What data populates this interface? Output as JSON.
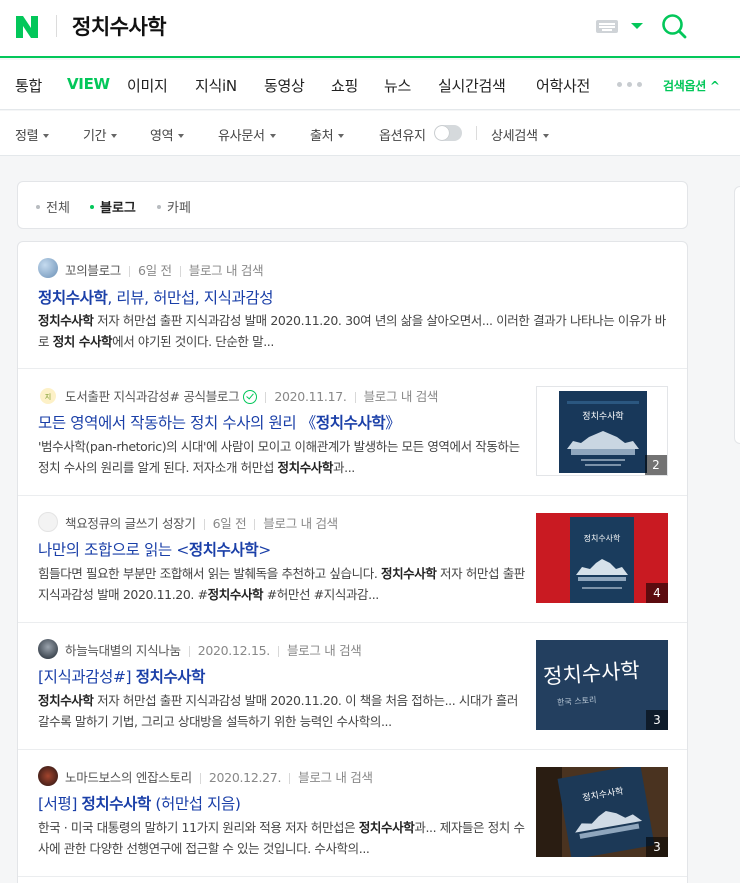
{
  "header": {
    "query": "정치수사학"
  },
  "colors": {
    "brand_green": "#03c75a",
    "link_blue": "#1a3fa8"
  },
  "nav": {
    "tabs": [
      "통합",
      "VIEW",
      "이미지",
      "지식iN",
      "동영상",
      "쇼핑",
      "뉴스",
      "실시간검색",
      "어학사전"
    ],
    "active": "VIEW",
    "search_options": "검색옵션 ^"
  },
  "filters": {
    "items": [
      "정렬",
      "기간",
      "영역",
      "유사문서",
      "출처"
    ],
    "keep_option": "옵션유지",
    "detail_search": "상세검색"
  },
  "subtabs": {
    "items": [
      "전체",
      "블로그",
      "카페"
    ],
    "active": "블로그"
  },
  "results": [
    {
      "source": "꼬의블로그",
      "date": "6일 전",
      "blog_search": "블로그 내 검색",
      "title_parts": [
        [
          "b",
          "정치수사학"
        ],
        [
          "",
          ", 리뷰, 허만섭, 지식과감성"
        ]
      ],
      "snippet_parts": [
        [
          "b",
          "정치수사학"
        ],
        [
          "",
          " 저자 허만섭 출판 지식과감성 발매 2020.11.20. 30여 년의 삶을 살아오면서... 이러한 결과가 나타나는 이유가 바로 "
        ],
        [
          "b",
          "정치 수사학"
        ],
        [
          "",
          "에서 야기된 것이다. 단순한 말..."
        ]
      ],
      "thumb_count": null
    },
    {
      "source": "도서출판 지식과감성# 공식블로그",
      "date": "2020.11.17.",
      "blog_search": "블로그 내 검색",
      "title_parts": [
        [
          "",
          "모든 영역에서 작동하는 정치 수사의 원리 《"
        ],
        [
          "b",
          "정치수사학"
        ],
        [
          "",
          "》"
        ]
      ],
      "snippet_parts": [
        [
          "",
          "'범수사학(pan-rhetoric)의 시대'에 사람이 모이고 이해관계가 발생하는 모든 영역에서 작동하는 정치 수사의 원리를 알게 된다. 저자소개 허만섭 "
        ],
        [
          "b",
          "정치수사학"
        ],
        [
          "",
          "과..."
        ]
      ],
      "thumb_count": "2"
    },
    {
      "source": "책요정큐의 글쓰기 성장기",
      "date": "6일 전",
      "blog_search": "블로그 내 검색",
      "title_parts": [
        [
          "",
          "나만의 조합으로 읽는 <"
        ],
        [
          "b",
          "정치수사학"
        ],
        [
          "",
          ">"
        ]
      ],
      "snippet_parts": [
        [
          "",
          "힘들다면 필요한 부분만 조합해서 읽는 발췌독을 추천하고 싶습니다. "
        ],
        [
          "b",
          "정치수사학"
        ],
        [
          "",
          " 저자 허만섭 출판 지식과감성 발매 2020.11.20. #"
        ],
        [
          "b",
          "정치수사학"
        ],
        [
          "",
          " #허만선 #지식과감..."
        ]
      ],
      "thumb_count": "4"
    },
    {
      "source": "하늘늑대별의 지식나눔",
      "date": "2020.12.15.",
      "blog_search": "블로그 내 검색",
      "title_parts": [
        [
          "",
          "[지식과감성#] "
        ],
        [
          "b",
          "정치수사학"
        ]
      ],
      "snippet_parts": [
        [
          "b",
          "정치수사학"
        ],
        [
          "",
          " 저자 허만섭 출판 지식과감성 발매 2020.11.20. 이 책을 처음 접하는... 시대가 흘러갈수록 말하기 기법, 그리고 상대방을 설득하기 위한 능력인 수사학의..."
        ]
      ],
      "thumb_count": "3"
    },
    {
      "source": "노마드보스의 엔잡스토리",
      "date": "2020.12.27.",
      "blog_search": "블로그 내 검색",
      "title_parts": [
        [
          "",
          "[서평] "
        ],
        [
          "b",
          "정치수사학"
        ],
        [
          "",
          " (허만섭 지음)"
        ]
      ],
      "snippet_parts": [
        [
          "",
          "한국 · 미국 대통령의 말하기 11가지 원리와 적용 저자 허만섭은 "
        ],
        [
          "b",
          "정치수사학"
        ],
        [
          "",
          "과... 제자들은 정치 수사에 관한 다양한 선행연구에 접근할 수 있는 것입니다. 수사학의..."
        ]
      ],
      "thumb_count": "3"
    }
  ],
  "thumb_text": {
    "t2": "정치수사학",
    "t3": "정치수사학",
    "t4": "정치수사학",
    "t4_sub": "한국 스토리",
    "t5": "정치수사학"
  }
}
